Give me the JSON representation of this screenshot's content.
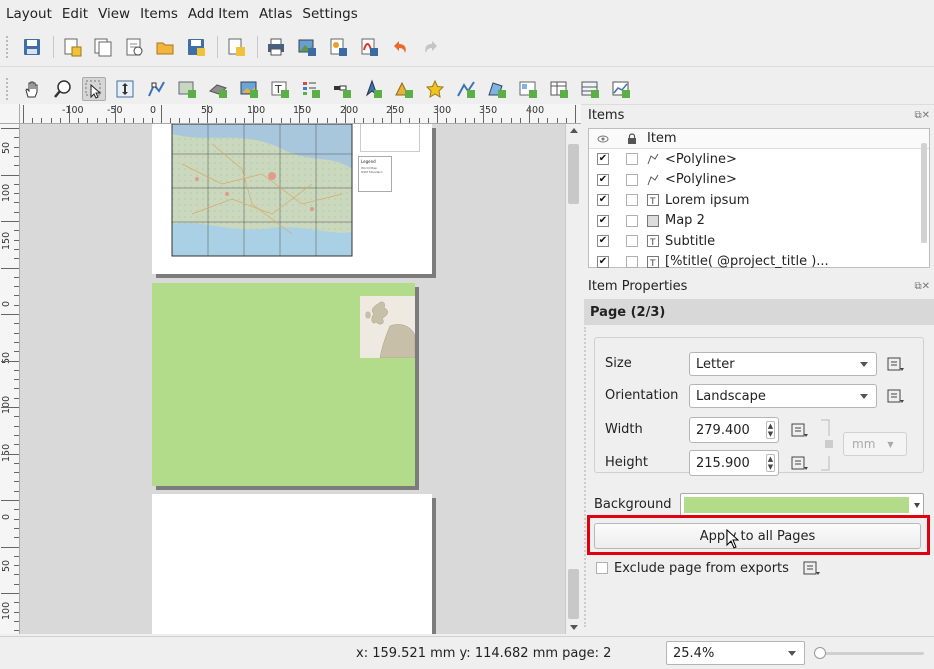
{
  "menu": [
    "Layout",
    "Edit",
    "View",
    "Items",
    "Add Item",
    "Atlas",
    "Settings"
  ],
  "toolbar1_icons": [
    "save-icon",
    "new-layout-icon",
    "duplicate-layout-icon",
    "layout-manager-icon",
    "open-template-icon",
    "save-template-icon",
    "add-pages-icon",
    "print-icon",
    "export-image-icon",
    "export-svg-icon",
    "export-pdf-icon",
    "undo-icon",
    "redo-icon"
  ],
  "toolbar2_icons": [
    "pan-icon",
    "zoom-icon",
    "select-icon",
    "move-content-icon",
    "edit-nodes-icon",
    "add-map-icon",
    "add-3d-map-icon",
    "add-picture-icon",
    "add-label-icon",
    "add-legend-icon",
    "add-scalebar-icon",
    "add-north-arrow-icon",
    "add-shape-icon",
    "add-marker-icon",
    "add-polyline-icon",
    "add-polygon-icon",
    "add-html-icon",
    "add-attribute-table-icon",
    "add-fixed-table-icon",
    "add-chart-icon"
  ],
  "ruler": {
    "top_labels": [
      "-100",
      "-50",
      "0",
      "50",
      "100",
      "150",
      "200",
      "250",
      "300",
      "350",
      "400"
    ],
    "left_labels": [
      "50",
      "100",
      "150",
      "0",
      "50",
      "100",
      "150",
      "0",
      "50",
      "100"
    ]
  },
  "canvas": {
    "page_color": "#b2dc8a",
    "legend_title": "Legend",
    "legend_lines": [
      "World Map",
      "OSM Standard"
    ]
  },
  "items_panel": {
    "title": "Items",
    "col_item": "Item",
    "rows": [
      {
        "label": "<Polyline>",
        "icon": "polyline-icon",
        "visible": true
      },
      {
        "label": "<Polyline>",
        "icon": "polyline-icon",
        "visible": true
      },
      {
        "label": "Lorem ipsum",
        "icon": "label-icon",
        "visible": true
      },
      {
        "label": "Map 2",
        "icon": "map-icon",
        "visible": true
      },
      {
        "label": "Subtitle",
        "icon": "label-icon",
        "visible": true
      },
      {
        "label": "[%title( @project_title )...",
        "icon": "label-icon",
        "visible": true
      }
    ]
  },
  "properties": {
    "title": "Item Properties",
    "section": "Page (2/3)",
    "size_label": "Size",
    "size_value": "Letter",
    "orientation_label": "Orientation",
    "orientation_value": "Landscape",
    "width_label": "Width",
    "width_value": "279.400",
    "height_label": "Height",
    "height_value": "215.900",
    "unit_value": "mm",
    "background_label": "Background",
    "background_color": "#b2dc8a",
    "apply_label": "Apply to all Pages",
    "exclude_label": "Exclude page from exports"
  },
  "statusbar": {
    "coords": "x: 159.521 mm  y: 114.682 mm  page: 2",
    "zoom": "25.4%",
    "zoom_slider_level": 0.0
  },
  "colors": {
    "highlight": "#e0000f",
    "page_green": "#b2dc8a"
  }
}
